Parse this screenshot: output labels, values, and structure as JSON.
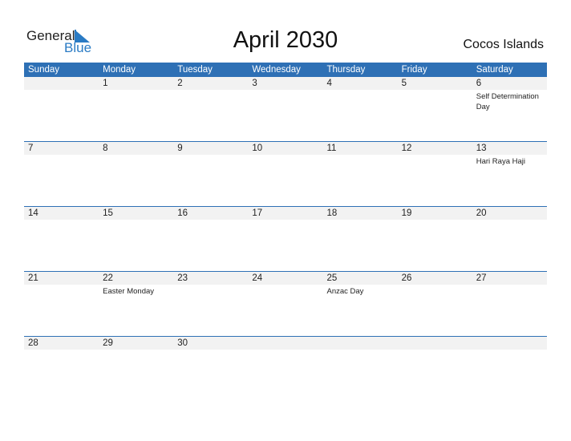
{
  "logo": {
    "general": "General",
    "blue": "Blue"
  },
  "title": "April 2030",
  "country": "Cocos Islands",
  "colors": {
    "accent": "#2e70b5",
    "row_bg": "#f2f2f2"
  },
  "days": [
    "Sunday",
    "Monday",
    "Tuesday",
    "Wednesday",
    "Thursday",
    "Friday",
    "Saturday"
  ],
  "weeks": [
    {
      "nums": [
        "",
        "1",
        "2",
        "3",
        "4",
        "5",
        "6"
      ],
      "events": [
        "",
        "",
        "",
        "",
        "",
        "",
        "Self Determination Day"
      ]
    },
    {
      "nums": [
        "7",
        "8",
        "9",
        "10",
        "11",
        "12",
        "13"
      ],
      "events": [
        "",
        "",
        "",
        "",
        "",
        "",
        "Hari Raya Haji"
      ]
    },
    {
      "nums": [
        "14",
        "15",
        "16",
        "17",
        "18",
        "19",
        "20"
      ],
      "events": [
        "",
        "",
        "",
        "",
        "",
        "",
        ""
      ]
    },
    {
      "nums": [
        "21",
        "22",
        "23",
        "24",
        "25",
        "26",
        "27"
      ],
      "events": [
        "",
        "Easter Monday",
        "",
        "",
        "Anzac Day",
        "",
        ""
      ]
    },
    {
      "nums": [
        "28",
        "29",
        "30",
        "",
        "",
        "",
        ""
      ],
      "events": [
        "",
        "",
        "",
        "",
        "",
        "",
        ""
      ]
    }
  ]
}
